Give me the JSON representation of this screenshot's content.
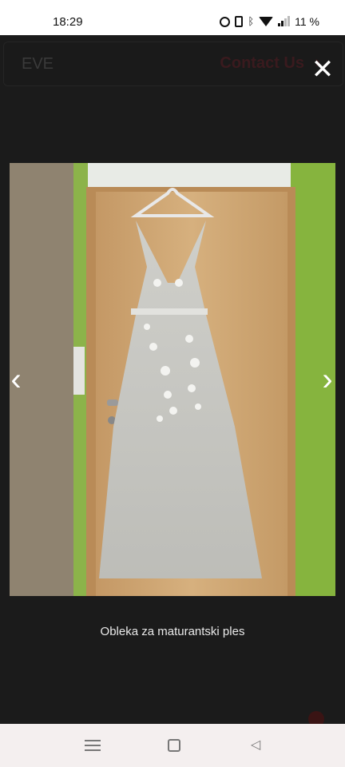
{
  "status_bar": {
    "time": "18:29",
    "battery": "11 %"
  },
  "page": {
    "brand": "EVE",
    "contact_label": "Contact Us"
  },
  "lightbox": {
    "caption": "Obleka za maturantski ples"
  },
  "icons": {
    "close": "close-icon",
    "prev": "chevron-left-icon",
    "next": "chevron-right-icon"
  }
}
